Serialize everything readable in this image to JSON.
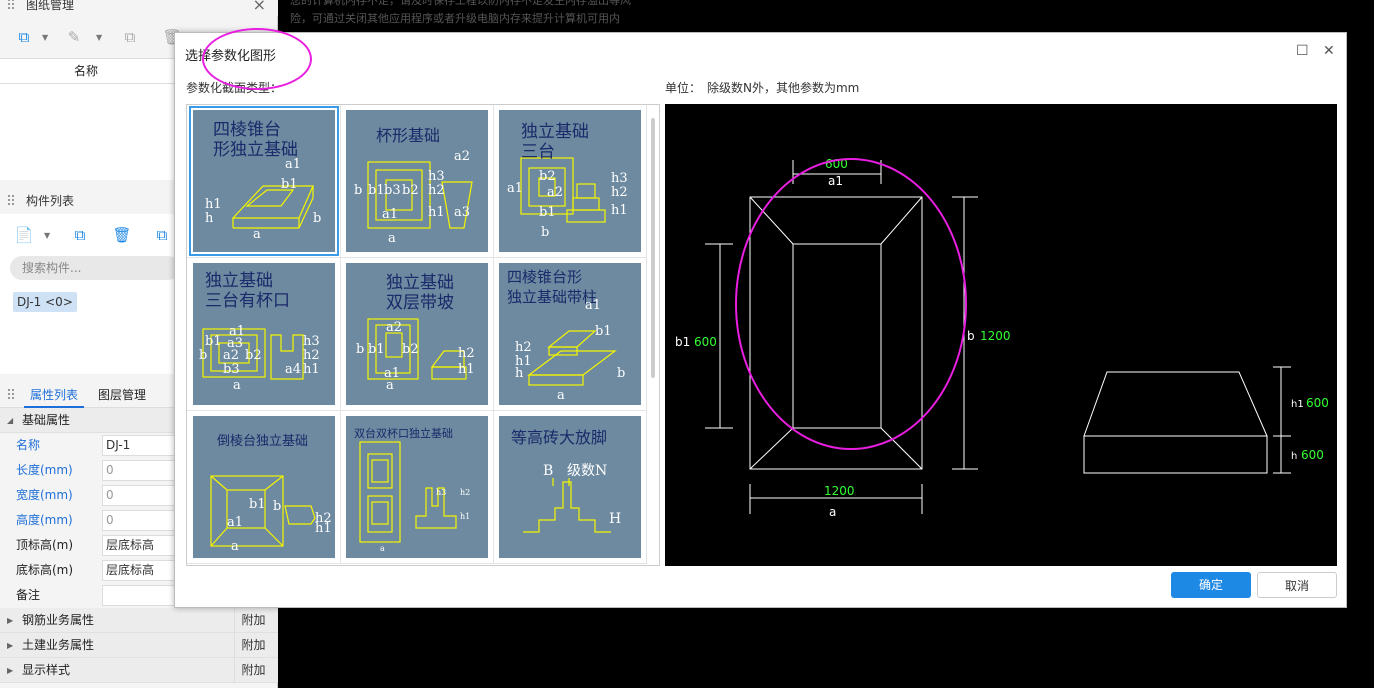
{
  "background": {
    "message_line1": "您的计算机内存不足，请及时保存工程以防内存不足发生内存溢出等风",
    "message_line2": "险，可通过关闭其他应用程序或者升级电脑内存来提升计算机可用内"
  },
  "drawings_panel": {
    "title": "图纸管理",
    "close": "×",
    "column_name": "名称"
  },
  "components_panel": {
    "title": "构件列表",
    "search_placeholder": "搜索构件...",
    "item": "DJ-1 <0>"
  },
  "properties_panel": {
    "tabs": [
      "属性列表",
      "图层管理"
    ],
    "group_basic": "基础属性",
    "rows": [
      {
        "label": "名称",
        "value": "DJ-1"
      },
      {
        "label": "长度(mm)",
        "value": "0"
      },
      {
        "label": "宽度(mm)",
        "value": "0"
      },
      {
        "label": "高度(mm)",
        "value": "0"
      },
      {
        "label": "顶标高(m)",
        "value": "层底标高"
      },
      {
        "label": "底标高(m)",
        "value": "层底标高"
      },
      {
        "label": "备注",
        "value": ""
      }
    ],
    "groups": [
      {
        "label": "钢筋业务属性",
        "extra": "附加"
      },
      {
        "label": "土建业务属性",
        "extra": "附加"
      },
      {
        "label": "显示样式",
        "extra": "附加"
      }
    ]
  },
  "dialog": {
    "title": "选择参数化图形",
    "section_label": "参数化截面类型：",
    "unit_label": "单位：　除级数N外，其他参数为mm",
    "maximize": "☐",
    "close": "✕",
    "ok": "确定",
    "cancel": "取消",
    "shapes": [
      {
        "title_l1": "四棱锥台",
        "title_l2": "形独立基础",
        "labels": [
          "a1",
          "b1",
          "h1",
          "h",
          "a",
          "b"
        ]
      },
      {
        "title_l1": "杯形基础",
        "title_l2": "",
        "labels": [
          "a2",
          "h3",
          "h2",
          "h1",
          "a3",
          "b",
          "b1",
          "b3",
          "b2",
          "a1",
          "a"
        ]
      },
      {
        "title_l1": "独立基础",
        "title_l2": "三台",
        "labels": [
          "b2",
          "a1",
          "a2",
          "b1",
          "b",
          "h3",
          "h2",
          "h1"
        ]
      },
      {
        "title_l1": "独立基础",
        "title_l2": "三台有杯口",
        "labels": [
          "a1",
          "a3",
          "b1",
          "a2",
          "b2",
          "b3",
          "a",
          "h3",
          "h2",
          "h1",
          "a4",
          "b"
        ]
      },
      {
        "title_l1": "独立基础",
        "title_l2": "双层带坡",
        "labels": [
          "a2",
          "b",
          "b1",
          "b2",
          "a1",
          "a",
          "h2",
          "h1"
        ]
      },
      {
        "title_l1": "四棱锥台形",
        "title_l2": "独立基础带柱",
        "labels": [
          "a1",
          "b1",
          "h2",
          "h1",
          "h",
          "a",
          "b"
        ]
      },
      {
        "title_l1": "倒棱台独立基础",
        "title_l2": "",
        "labels": [
          "a1",
          "a",
          "b1",
          "b",
          "h2",
          "h1"
        ]
      },
      {
        "title_l1": "双台双杯口独立基础",
        "title_l2": "",
        "labels": [
          "h2",
          "h1",
          "h3",
          "a"
        ]
      },
      {
        "title_l1": "等高砖大放脚",
        "title_l2": "",
        "labels": [
          "B",
          "级数N",
          "H"
        ]
      }
    ],
    "preview": {
      "a1_value": "600",
      "a1_label": "a1",
      "b1_label": "b1",
      "b1_value": "600",
      "b_label": "b",
      "b_value": "1200",
      "a_value": "1200",
      "a_label": "a",
      "h1_label": "h1",
      "h1_value": "600",
      "h_label": "h",
      "h_value": "600"
    }
  },
  "colors": {
    "accent": "#1e88e5",
    "annotation": "#e81ee0",
    "thumb_bg": "#6d8aa0",
    "drawing_yellow": "#f5f500",
    "dim_green": "#33ff33"
  }
}
